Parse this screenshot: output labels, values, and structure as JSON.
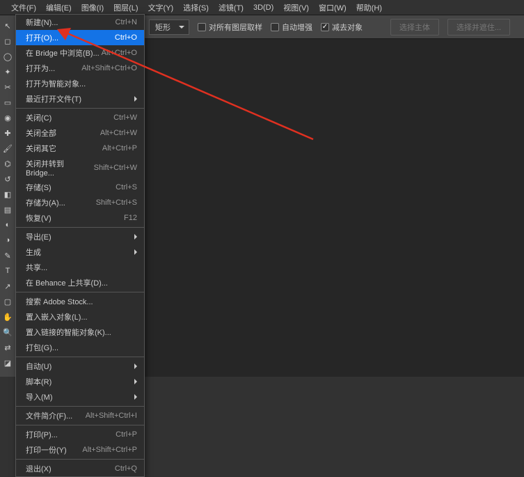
{
  "menubar": {
    "items": [
      "文件(F)",
      "编辑(E)",
      "图像(I)",
      "图层(L)",
      "文字(Y)",
      "选择(S)",
      "滤镜(T)",
      "3D(D)",
      "视图(V)",
      "窗口(W)",
      "帮助(H)"
    ]
  },
  "optionsbar": {
    "shape_select": "矩形",
    "checkbox1": "对所有图层取样",
    "checkbox2": "自动增强",
    "checkbox3": "减去对象",
    "btn1": "选择主体",
    "btn2": "选择并遮住..."
  },
  "tools": [
    "move",
    "marquee",
    "lasso",
    "wand",
    "crop",
    "frame",
    "eyedropper",
    "heal",
    "brush",
    "stamp",
    "history",
    "eraser",
    "gradient",
    "blur",
    "dodge",
    "pen",
    "type",
    "path",
    "rectangle",
    "hand",
    "zoom",
    "swap",
    "color"
  ],
  "dropdown": {
    "groups": [
      [
        {
          "label": "新建(N)...",
          "shortcut": "Ctrl+N"
        },
        {
          "label": "打开(O)...",
          "shortcut": "Ctrl+O",
          "highlighted": true
        },
        {
          "label": "在 Bridge 中浏览(B)...",
          "shortcut": "Alt+Ctrl+O"
        },
        {
          "label": "打开为...",
          "shortcut": "Alt+Shift+Ctrl+O"
        },
        {
          "label": "打开为智能对象..."
        },
        {
          "label": "最近打开文件(T)",
          "sub": true
        }
      ],
      [
        {
          "label": "关闭(C)",
          "shortcut": "Ctrl+W"
        },
        {
          "label": "关闭全部",
          "shortcut": "Alt+Ctrl+W"
        },
        {
          "label": "关闭其它",
          "shortcut": "Alt+Ctrl+P"
        },
        {
          "label": "关闭并转到 Bridge...",
          "shortcut": "Shift+Ctrl+W"
        },
        {
          "label": "存储(S)",
          "shortcut": "Ctrl+S"
        },
        {
          "label": "存储为(A)...",
          "shortcut": "Shift+Ctrl+S"
        },
        {
          "label": "恢复(V)",
          "shortcut": "F12"
        }
      ],
      [
        {
          "label": "导出(E)",
          "sub": true
        },
        {
          "label": "生成",
          "sub": true
        },
        {
          "label": "共享..."
        },
        {
          "label": "在 Behance 上共享(D)..."
        }
      ],
      [
        {
          "label": "搜索 Adobe Stock..."
        },
        {
          "label": "置入嵌入对象(L)..."
        },
        {
          "label": "置入链接的智能对象(K)..."
        },
        {
          "label": "打包(G)..."
        }
      ],
      [
        {
          "label": "自动(U)",
          "sub": true
        },
        {
          "label": "脚本(R)",
          "sub": true
        },
        {
          "label": "导入(M)",
          "sub": true
        }
      ],
      [
        {
          "label": "文件简介(F)...",
          "shortcut": "Alt+Shift+Ctrl+I"
        }
      ],
      [
        {
          "label": "打印(P)...",
          "shortcut": "Ctrl+P"
        },
        {
          "label": "打印一份(Y)",
          "shortcut": "Alt+Shift+Ctrl+P"
        }
      ],
      [
        {
          "label": "退出(X)",
          "shortcut": "Ctrl+Q"
        }
      ]
    ]
  }
}
